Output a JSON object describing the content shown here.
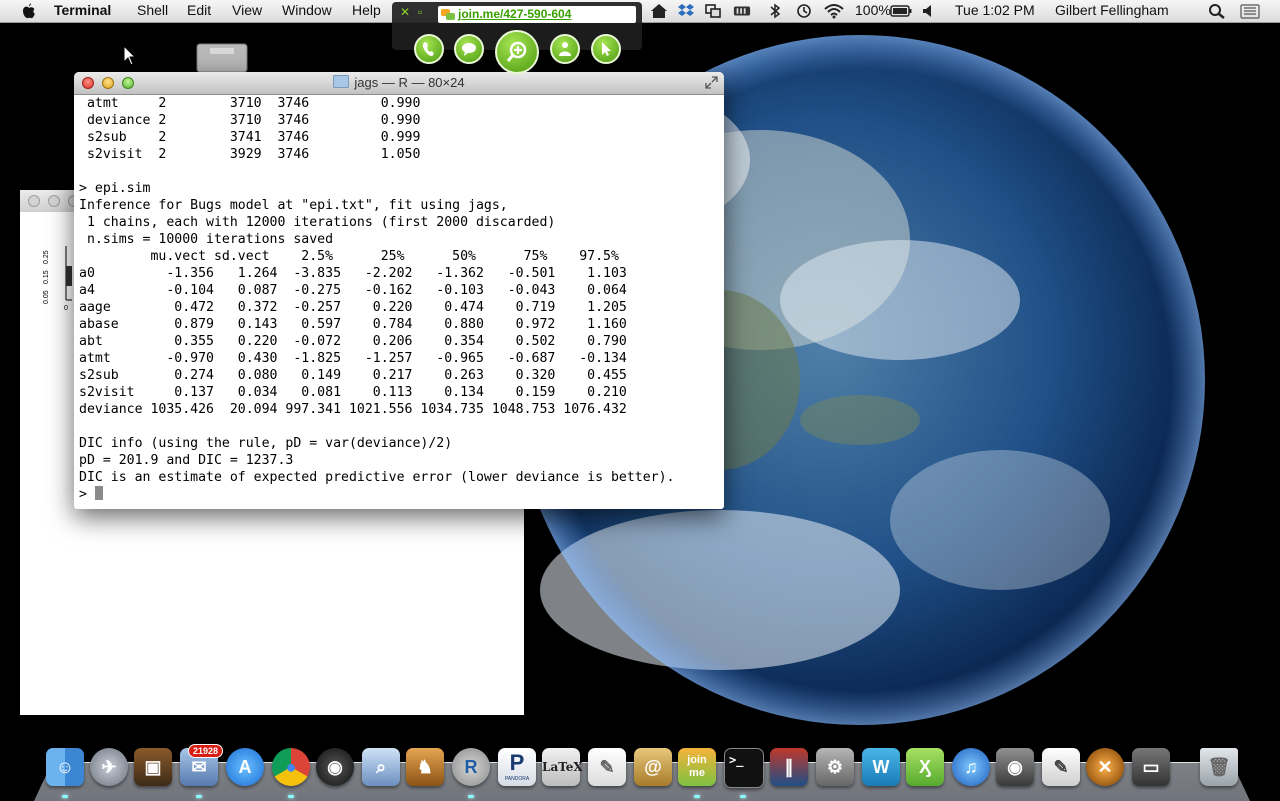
{
  "menubar": {
    "app_name": "Terminal",
    "menus": [
      "Shell",
      "Edit",
      "View",
      "Window",
      "Help"
    ],
    "battery": "100%",
    "clock": "Tue 1:02 PM",
    "user": "Gilbert Fellingham"
  },
  "joinme": {
    "url": "join.me/427-590-604",
    "buttons": [
      "phone",
      "chat",
      "zoom",
      "people",
      "pointer"
    ]
  },
  "terminal": {
    "title": "jags — R — 80×24",
    "lines": [
      " atmt     2        3710  3746         0.990",
      " deviance 2        3710  3746         0.990",
      " s2sub    2        3741  3746         0.999",
      " s2visit  2        3929  3746         1.050",
      "",
      "> epi.sim",
      "Inference for Bugs model at \"epi.txt\", fit using jags,",
      " 1 chains, each with 12000 iterations (first 2000 discarded)",
      " n.sims = 10000 iterations saved",
      "         mu.vect sd.vect    2.5%      25%      50%      75%    97.5%",
      "a0         -1.356   1.264  -3.835   -2.202   -1.362   -0.501    1.103",
      "a4         -0.104   0.087  -0.275   -0.162   -0.103   -0.043    0.064",
      "aage        0.472   0.372  -0.257    0.220    0.474    0.719    1.205",
      "abase       0.879   0.143   0.597    0.784    0.880    0.972    1.160",
      "abt         0.355   0.220  -0.072    0.206    0.354    0.502    0.790",
      "atmt       -0.970   0.430  -1.825   -1.257   -0.965   -0.687   -0.134",
      "s2sub       0.274   0.080   0.149    0.217    0.263    0.320    0.455",
      "s2visit     0.137   0.034   0.081    0.113    0.134    0.159    0.210",
      "deviance 1035.426  20.094 997.341 1021.556 1034.735 1048.753 1076.432",
      "",
      "DIC info (using the rule, pD = var(deviance)/2)",
      "pD = 201.9 and DIC = 1237.3",
      "DIC is an estimate of expected predictive error (lower deviance is better).",
      "> "
    ]
  },
  "backwindow": {
    "y_ticks": [
      "0.25",
      "0.15",
      "0.05"
    ],
    "x_tick": "0"
  },
  "dock": {
    "mail_badge": "21928",
    "pandora_label": "PANDORA",
    "latex_label": "LaTeX",
    "joinme_label": "join me",
    "items": [
      "Finder",
      "Launchpad",
      "Photo Booth",
      "Mail",
      "App Store",
      "Chrome",
      "Dashboard",
      "Preview",
      "Growl",
      "R",
      "Pandora",
      "LaTeXiT",
      "TextEdit",
      "Contacts",
      "join.me",
      "Terminal",
      "Parallels",
      "System Preferences",
      "WinBox",
      "Tweetie",
      "iTunes",
      "FaceTime",
      "Script Editor",
      "X11",
      "Desktop Stack",
      "Trash"
    ]
  }
}
